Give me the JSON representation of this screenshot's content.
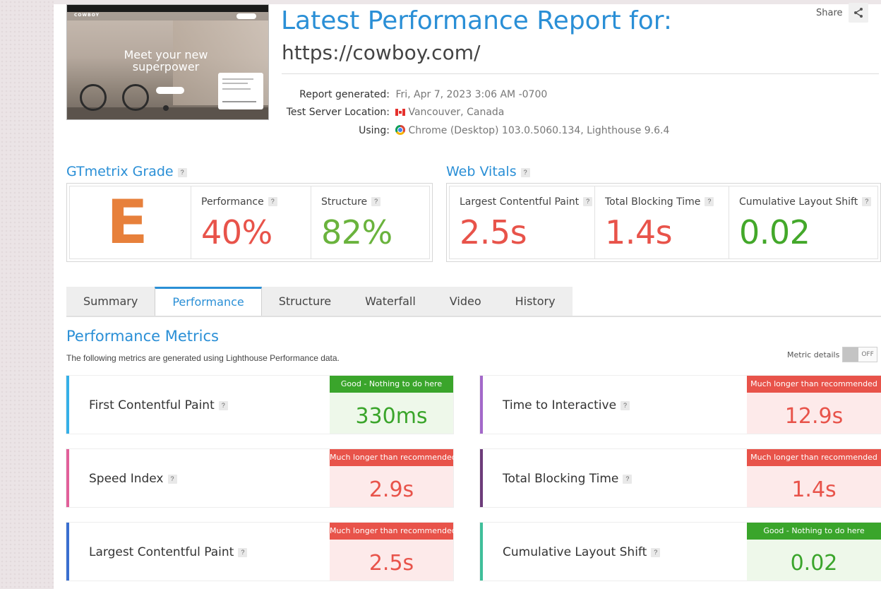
{
  "header": {
    "title": "Latest Performance Report for:",
    "url": "https://cowboy.com/",
    "share_label": "Share"
  },
  "thumbnail": {
    "logo": "COWBOY",
    "headline": "Meet your new superpower"
  },
  "report_info": {
    "generated_label": "Report generated:",
    "generated_value": "Fri, Apr 7, 2023 3:06 AM -0700",
    "location_label": "Test Server Location:",
    "location_value": "Vancouver, Canada",
    "using_label": "Using:",
    "using_value": "Chrome (Desktop) 103.0.5060.134, Lighthouse 9.6.4"
  },
  "grade": {
    "section_title": "GTmetrix Grade",
    "letter": "E",
    "performance_label": "Performance",
    "performance_value": "40%",
    "structure_label": "Structure",
    "structure_value": "82%"
  },
  "web_vitals": {
    "section_title": "Web Vitals",
    "lcp_label": "Largest Contentful Paint",
    "lcp_value": "2.5s",
    "tbt_label": "Total Blocking Time",
    "tbt_value": "1.4s",
    "cls_label": "Cumulative Layout Shift",
    "cls_value": "0.02"
  },
  "tabs": [
    {
      "label": "Summary",
      "active": false
    },
    {
      "label": "Performance",
      "active": true
    },
    {
      "label": "Structure",
      "active": false
    },
    {
      "label": "Waterfall",
      "active": false
    },
    {
      "label": "Video",
      "active": false
    },
    {
      "label": "History",
      "active": false
    }
  ],
  "performance_metrics": {
    "title": "Performance Metrics",
    "description": "The following metrics are generated using Lighthouse Performance data.",
    "details_label": "Metric details",
    "toggle_label": "OFF",
    "metrics": [
      {
        "name": "First Contentful Paint",
        "status": "Good - Nothing to do here",
        "value": "330ms"
      },
      {
        "name": "Time to Interactive",
        "status": "Much longer than recommended",
        "value": "12.9s"
      },
      {
        "name": "Speed Index",
        "status": "Much longer than recommended",
        "value": "2.9s"
      },
      {
        "name": "Total Blocking Time",
        "status": "Much longer than recommended",
        "value": "1.4s"
      },
      {
        "name": "Largest Contentful Paint",
        "status": "Much longer than recommended",
        "value": "2.5s"
      },
      {
        "name": "Cumulative Layout Shift",
        "status": "Good - Nothing to do here",
        "value": "0.02"
      }
    ]
  },
  "colors": {
    "brand_blue": "#2a8fd6",
    "bad_red": "#e8534a",
    "good_green": "#43a82a",
    "grade_orange": "#e7803b"
  }
}
